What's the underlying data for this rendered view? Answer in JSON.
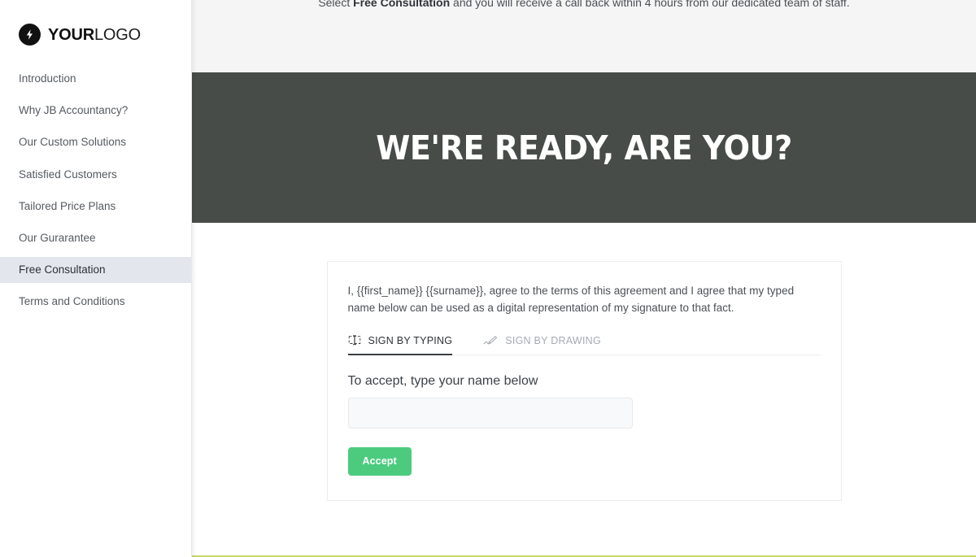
{
  "sidebar": {
    "logo": {
      "icon": "lightning-bolt-icon",
      "bold_part": "YOUR",
      "light_part": "LOGO"
    },
    "items": [
      {
        "label": "Introduction",
        "active": false
      },
      {
        "label": "Why JB Accountancy?",
        "active": false
      },
      {
        "label": "Our Custom Solutions",
        "active": false
      },
      {
        "label": "Satisfied Customers",
        "active": false
      },
      {
        "label": "Tailored Price Plans",
        "active": false
      },
      {
        "label": "Our Gurarantee",
        "active": false
      },
      {
        "label": "Free Consultation",
        "active": true
      },
      {
        "label": "Terms and Conditions",
        "active": false
      }
    ]
  },
  "intro": {
    "prefix": "Select ",
    "emphasis": "Free Consultation",
    "suffix": " and you will receive a call back within 4 hours from our dedicated team of staff."
  },
  "hero": {
    "title": "WE'RE READY, ARE YOU?",
    "background_color": "#484c49"
  },
  "signature_card": {
    "agreement_text": "I, {{first_name}} {{surname}}, agree to the terms of this agreement and I agree that my typed name below can be used as a digital representation of my signature to that fact.",
    "tabs": [
      {
        "label": "SIGN BY TYPING",
        "icon": "type-cursor-icon",
        "active": true
      },
      {
        "label": "SIGN BY DRAWING",
        "icon": "pen-signature-icon",
        "active": false
      }
    ],
    "field_label": "To accept, type your name below",
    "name_input": {
      "value": "",
      "placeholder": ""
    },
    "accept_button": {
      "label": "Accept",
      "color": "#4ccb7f"
    }
  },
  "footer": {
    "accent_color": "#c8d86e"
  }
}
